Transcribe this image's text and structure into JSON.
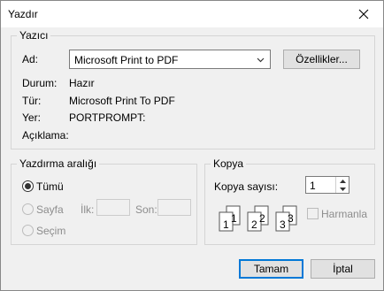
{
  "window": {
    "title": "Yazdır"
  },
  "printer": {
    "group_title": "Yazıcı",
    "name_label": "Ad:",
    "name_value": "Microsoft Print to PDF",
    "properties_button": "Özellikler...",
    "status_label": "Durum:",
    "status_value": "Hazır",
    "type_label": "Tür:",
    "type_value": "Microsoft Print To PDF",
    "where_label": "Yer:",
    "where_value": "PORTPROMPT:",
    "comment_label": "Açıklama:"
  },
  "print_range": {
    "group_title": "Yazdırma aralığı",
    "all_label": "Tümü",
    "pages_label": "Sayfa",
    "from_label": "İlk:",
    "to_label": "Son:",
    "selection_label": "Seçim"
  },
  "copies": {
    "group_title": "Kopya",
    "count_label": "Kopya sayısı:",
    "count_value": "1",
    "collate_label": "Harmanla",
    "collate_glyphs": [
      "1",
      "1",
      "2",
      "2",
      "3",
      "3"
    ]
  },
  "buttons": {
    "ok": "Tamam",
    "cancel": "İptal"
  }
}
